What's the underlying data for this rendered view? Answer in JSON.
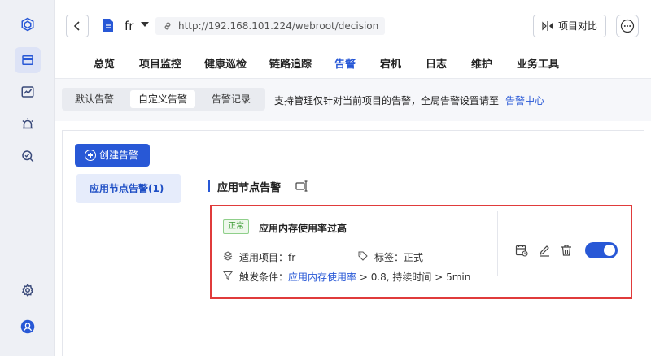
{
  "rail": {
    "items": [
      {
        "name": "logo-icon"
      },
      {
        "name": "layers-icon",
        "active": true
      },
      {
        "name": "chart-icon"
      },
      {
        "name": "alarm-icon"
      },
      {
        "name": "search-shield-icon"
      },
      {
        "name": "settings-icon"
      },
      {
        "name": "user-icon"
      }
    ]
  },
  "header": {
    "project_name": "fr",
    "url": "http://192.168.101.224/webroot/decision",
    "compare_label": "项目对比"
  },
  "nav": {
    "tabs": [
      "总览",
      "项目监控",
      "健康巡检",
      "链路追踪",
      "告警",
      "宕机",
      "日志",
      "维护",
      "业务工具"
    ],
    "active_index": 4
  },
  "subtabs": {
    "items": [
      "默认告警",
      "自定义告警",
      "告警记录"
    ],
    "active_index": 1,
    "hint": "支持管理仅针对当前项目的告警，全局告警设置请至",
    "hint_link": "告警中心"
  },
  "content": {
    "create_label": "创建告警",
    "side_items": [
      "应用节点告警(1)"
    ],
    "section_title": "应用节点告警",
    "alert": {
      "status": "正常",
      "title": "应用内存使用率过高",
      "project_label": "适用项目：fr",
      "tag_label": "标签：正式",
      "trigger_prefix": "触发条件：",
      "trigger_metric": "应用内存使用率",
      "trigger_rest": " > 0.8, 持续时间 > 5min",
      "enabled": true
    }
  },
  "colors": {
    "accent": "#2858d6",
    "highlight_border": "#e03b3b",
    "status_green": "#3a9a32"
  }
}
